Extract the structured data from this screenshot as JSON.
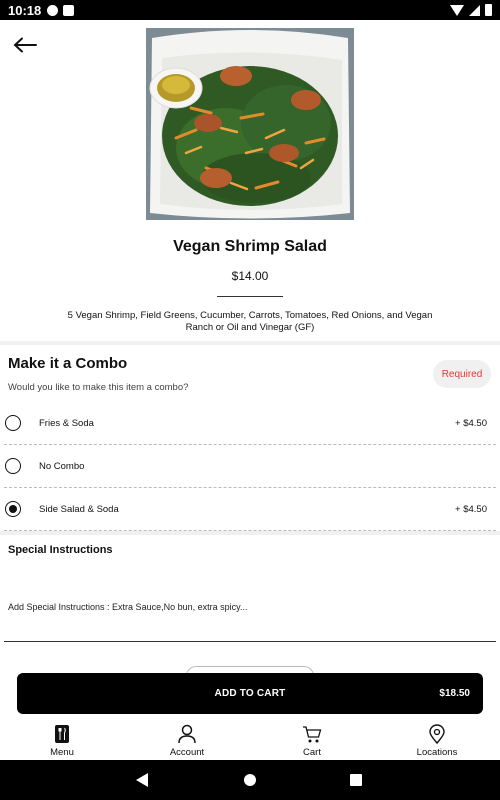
{
  "status_bar": {
    "time": "10:18"
  },
  "item": {
    "title": "Vegan Shrimp Salad",
    "price": "$14.00",
    "description": "5 Vegan Shrimp, Field Greens, Cucumber, Carrots, Tomatoes, Red Onions, and Vegan Ranch or Oil and Vinegar (GF)"
  },
  "combo": {
    "title": "Make it a Combo",
    "subtitle": "Would you like to make this item a combo?",
    "required_label": "Required",
    "options": [
      {
        "label": "Fries & Soda",
        "price": "+ $4.50",
        "selected": false
      },
      {
        "label": "No Combo",
        "price": "",
        "selected": false
      },
      {
        "label": "Side Salad & Soda",
        "price": "+ $4.50",
        "selected": true
      }
    ]
  },
  "special_instructions": {
    "title": "Special Instructions",
    "placeholder": "Add Special Instructions : Extra Sauce,No bun, extra spicy..."
  },
  "cart_button": {
    "label": "ADD TO CART",
    "total": "$18.50"
  },
  "tabs": [
    {
      "label": "Menu",
      "icon": "menu-utensils-icon",
      "active": true
    },
    {
      "label": "Account",
      "icon": "person-icon",
      "active": false
    },
    {
      "label": "Cart",
      "icon": "cart-icon",
      "active": false
    },
    {
      "label": "Locations",
      "icon": "location-pin-icon",
      "active": false
    }
  ],
  "colors": {
    "accent": "#000000",
    "required": "#e53935"
  }
}
